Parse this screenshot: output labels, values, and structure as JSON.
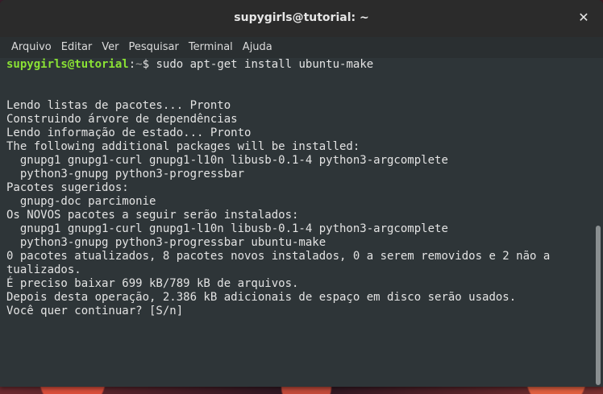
{
  "window": {
    "title": "supygirls@tutorial: ~",
    "close_glyph": "✕"
  },
  "menu": {
    "items": [
      "Arquivo",
      "Editar",
      "Ver",
      "Pesquisar",
      "Terminal",
      "Ajuda"
    ]
  },
  "terminal": {
    "prompt_user": "supygirls@tutorial",
    "prompt_sep": ":",
    "prompt_path": "~",
    "prompt_symbol": "$",
    "command": " sudo apt-get install ubuntu-make",
    "output_lines": [
      "",
      "",
      "Lendo listas de pacotes... Pronto",
      "Construindo árvore de dependências",
      "Lendo informação de estado... Pronto",
      "The following additional packages will be installed:",
      "  gnupg1 gnupg1-curl gnupg1-l10n libusb-0.1-4 python3-argcomplete",
      "  python3-gnupg python3-progressbar",
      "Pacotes sugeridos:",
      "  gnupg-doc parcimonie",
      "Os NOVOS pacotes a seguir serão instalados:",
      "  gnupg1 gnupg1-curl gnupg1-l10n libusb-0.1-4 python3-argcomplete",
      "  python3-gnupg python3-progressbar ubuntu-make",
      "0 pacotes atualizados, 8 pacotes novos instalados, 0 a serem removidos e 2 não a",
      "tualizados.",
      "É preciso baixar 699 kB/789 kB de arquivos.",
      "Depois desta operação, 2.386 kB adicionais de espaço em disco serão usados.",
      "Você quer continuar? [S/n]"
    ]
  },
  "colors": {
    "prompt_user": "#8ae234",
    "terminal_bg": "#2e3538",
    "text": "#e3e3e3"
  }
}
